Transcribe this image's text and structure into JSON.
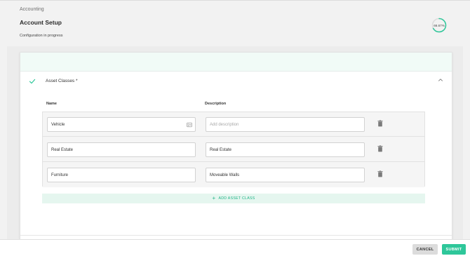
{
  "header": {
    "breadcrumb": "Accounting",
    "title": "Account Setup",
    "subtitle": "Configuration in progress",
    "progress_label": "66.67%",
    "progress_value": 0.6667
  },
  "section": {
    "title": "Asset Classes *",
    "columns": {
      "name": "Name",
      "description": "Description"
    },
    "rows": [
      {
        "name": "Vehicle",
        "description": "",
        "description_placeholder": "Add description"
      },
      {
        "name": "Real Estate",
        "description": "Real Estate"
      },
      {
        "name": "Furniture",
        "description": "Moveable Walls"
      }
    ],
    "add_label": "ADD ASSET CLASS"
  },
  "footer": {
    "cancel_label": "CANCEL",
    "submit_label": "SUBMIT"
  },
  "colors": {
    "accent": "#2ec79a",
    "accent_light": "#e5f6ef",
    "progress_track": "#dcdcdc"
  },
  "icons": {
    "section_status": "checkmark-icon",
    "collapse": "chevron-up-icon",
    "row_delete": "trash-icon",
    "field_action": "id-card-icon",
    "add": "plus-icon"
  }
}
